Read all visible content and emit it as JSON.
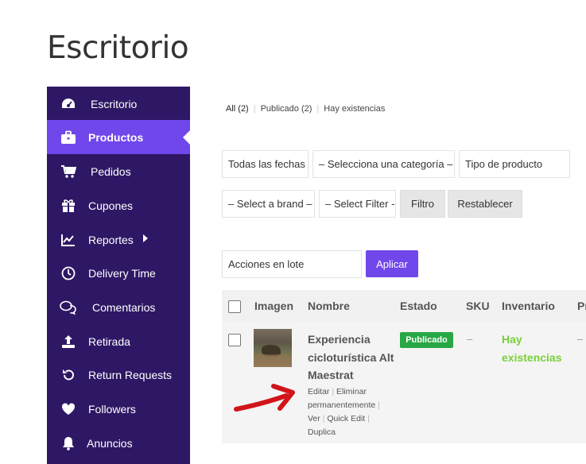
{
  "page": {
    "title": "Escritorio"
  },
  "sidebar": {
    "items": [
      {
        "label": "Escritorio",
        "icon": "dashboard-icon"
      },
      {
        "label": "Productos",
        "icon": "briefcase-icon",
        "active": true
      },
      {
        "label": "Pedidos",
        "icon": "cart-icon"
      },
      {
        "label": "Cupones",
        "icon": "gift-icon"
      },
      {
        "label": "Reportes",
        "icon": "chart-icon"
      },
      {
        "label": "Delivery Time",
        "icon": "clock-icon"
      },
      {
        "label": "Comentarios",
        "icon": "comments-icon"
      },
      {
        "label": "Retirada",
        "icon": "upload-icon"
      },
      {
        "label": "Return Requests",
        "icon": "undo-icon"
      },
      {
        "label": "Followers",
        "icon": "heart-icon"
      },
      {
        "label": "Anuncios",
        "icon": "bell-icon"
      }
    ]
  },
  "status_links": {
    "all": "All (2)",
    "published": "Publicado (2)",
    "in_stock": "Hay existencias"
  },
  "filters": {
    "dates": "Todas las fechas",
    "category": "– Selecciona una categoría –",
    "product_type": "Tipo de producto",
    "brand": "– Select a brand –",
    "filter": "– Select Filter -",
    "filter_button": "Filtro",
    "reset_button": "Restablecer"
  },
  "bulk": {
    "select": "Acciones en lote",
    "apply": "Aplicar"
  },
  "table": {
    "headers": {
      "image": "Imagen",
      "name": "Nombre",
      "status": "Estado",
      "sku": "SKU",
      "inventory": "Inventario",
      "price": "Pr"
    },
    "rows": [
      {
        "name": "Experiencia cicloturística Alt Maestrat",
        "actions": {
          "edit": "Editar",
          "delete": "Eliminar permanentemente",
          "view": "Ver",
          "quick_edit": "Quick Edit",
          "duplicate": "Duplica"
        },
        "status": "Publicado",
        "sku": "–",
        "inventory": "Hay existencias",
        "price": "–"
      }
    ]
  },
  "colors": {
    "sidebar": "#2e1865",
    "accent": "#7047eb",
    "published": "#28a745",
    "in_stock": "#7ad03a",
    "annotation_arrow": "#d0151b"
  }
}
